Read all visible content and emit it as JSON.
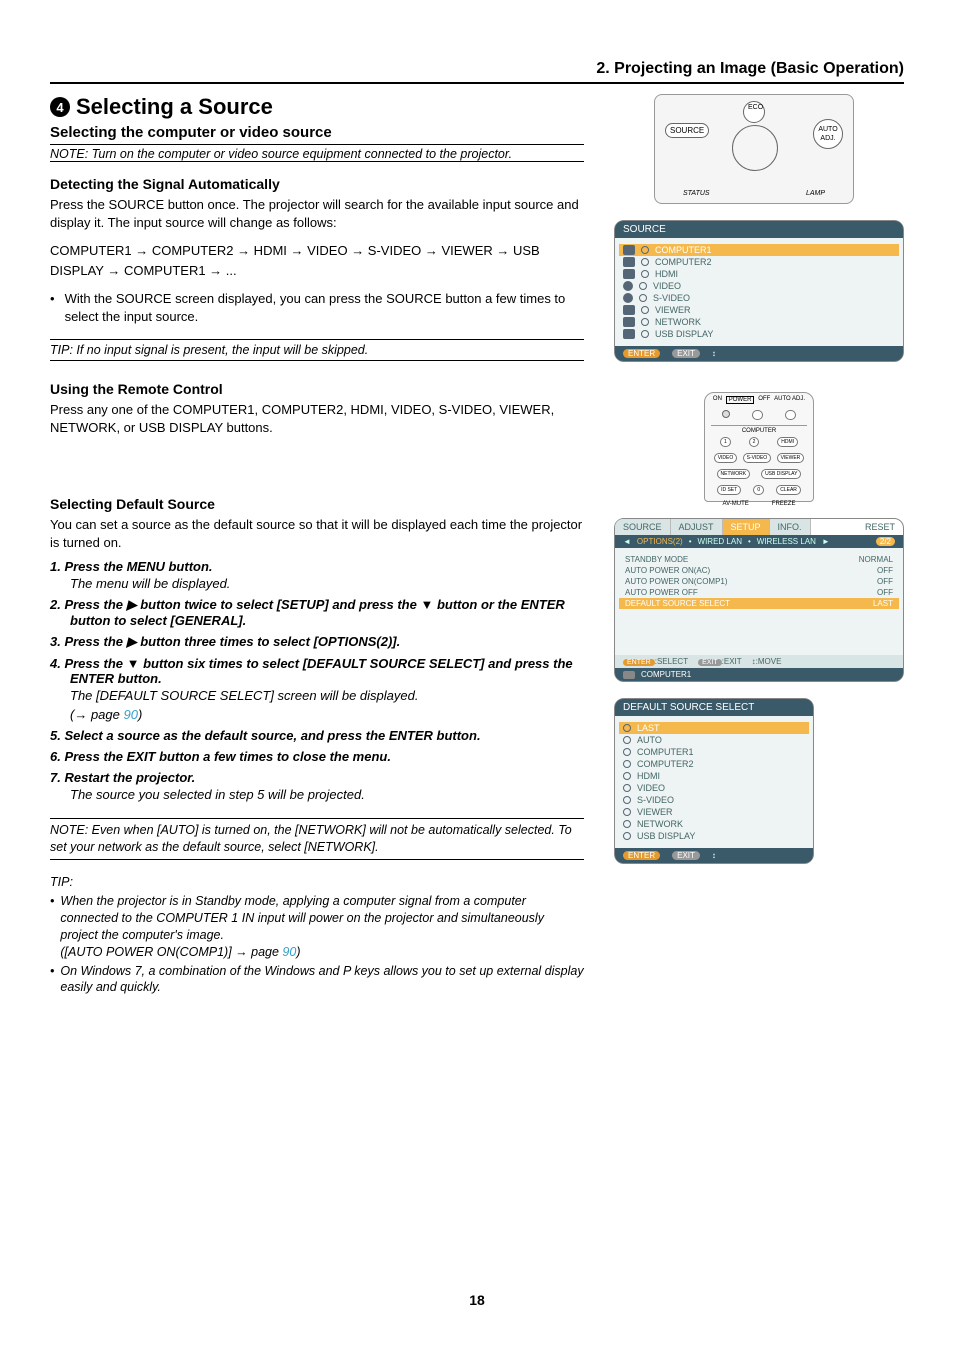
{
  "chapter_header": "2. Projecting an Image (Basic Operation)",
  "section": {
    "number": "4",
    "title": "Selecting a Source",
    "subhead": "Selecting the computer or video source",
    "note_top": "NOTE: Turn on the computer or video source equipment connected to the projector."
  },
  "detect": {
    "heading": "Detecting the Signal Automatically",
    "p1": "Press the SOURCE button once. The projector will search for the available input source and display it. The input source will change as follows:",
    "chain": "COMPUTER1 → COMPUTER2 → HDMI → VIDEO → S-VIDEO → VIEWER → USB DISPLAY → COMPUTER1 → ...",
    "bullet": "With the SOURCE screen displayed, you can press the SOURCE button a few times to select the input source.",
    "tip": "TIP: If no input signal is present, the input will be skipped."
  },
  "remote": {
    "heading": "Using the Remote Control",
    "p1": "Press any one of the COMPUTER1, COMPUTER2, HDMI, VIDEO, S-VIDEO, VIEWER, NETWORK, or USB DISPLAY buttons."
  },
  "default_source": {
    "heading": "Selecting Default Source",
    "intro": "You can set a source as the default source so that it will be displayed each time the projector is turned on.",
    "step1": "1.  Press the MENU button.",
    "step1_sub": "The menu will be displayed.",
    "step2": "2.  Press the ▶ button twice to select [SETUP] and press the ▼ button or the ENTER button to select [GENERAL].",
    "step3": "3.  Press the ▶ button three times to select [OPTIONS(2)].",
    "step4": "4.  Press the ▼ button six times to select [DEFAULT SOURCE SELECT] and press the ENTER button.",
    "step4_sub1": "The [DEFAULT SOURCE SELECT] screen will be displayed.",
    "step4_sub2_prefix": "(→ page ",
    "step4_sub2_link": "90",
    "step4_sub2_suffix": ")",
    "step5": "5.  Select a source as the default source, and press the ENTER button.",
    "step6": "6.  Press the EXIT button a few times to close the menu.",
    "step7": "7.  Restart the projector.",
    "step7_sub": "The source you selected in step 5 will be projected."
  },
  "note_bottom": "NOTE: Even when [AUTO] is turned on, the [NETWORK] will not be automatically selected. To set your network as the default source, select [NETWORK].",
  "tips": {
    "lead": "TIP:",
    "t1_a": "When the projector is in Standby mode, applying a computer signal from a computer connected to the COMPUTER 1 IN input will power on the projector and simultaneously project the computer's image.",
    "t1_b_prefix": "([AUTO POWER ON(COMP1)] → page ",
    "t1_b_link": "90",
    "t1_b_suffix": ")",
    "t2": "On Windows 7, a combination of the Windows and P keys allows you to set up external display easily and quickly."
  },
  "page_number": "18",
  "fig_control": {
    "source": "SOURCE",
    "eco": "ECO",
    "auto": "AUTO ADJ.",
    "status": "STATUS",
    "lamp": "LAMP"
  },
  "fig_source_osd": {
    "title": "SOURCE",
    "items": [
      "COMPUTER1",
      "COMPUTER2",
      "HDMI",
      "VIDEO",
      "S-VIDEO",
      "VIEWER",
      "NETWORK",
      "USB DISPLAY"
    ],
    "enter": "ENTER",
    "exit": "EXIT"
  },
  "fig_remote": {
    "on": "ON",
    "power": "POWER",
    "off": "OFF",
    "auto": "AUTO ADJ.",
    "computer": "COMPUTER",
    "hdmi": "HDMI",
    "video": "VIDEO",
    "svideo": "S-VIDEO",
    "viewer": "VIEWER",
    "network": "NETWORK",
    "usb": "USB DISPLAY",
    "idset": "ID SET",
    "clear": "CLEAR",
    "avmute": "AV-MUTE",
    "freeze": "FREEZE"
  },
  "fig_setup": {
    "tabs": [
      "SOURCE",
      "ADJUST",
      "SETUP",
      "INFO."
    ],
    "reset": "RESET",
    "subtabs_sel": "OPTIONS(2)",
    "subtabs": [
      "WIRED LAN",
      "WIRELESS LAN"
    ],
    "page": "2/2",
    "rows": [
      {
        "l": "STANDBY MODE",
        "r": "NORMAL"
      },
      {
        "l": "AUTO POWER ON(AC)",
        "r": "OFF"
      },
      {
        "l": "AUTO POWER ON(COMP1)",
        "r": "OFF"
      },
      {
        "l": "AUTO POWER OFF",
        "r": "OFF"
      }
    ],
    "sel_row": {
      "l": "DEFAULT SOURCE SELECT",
      "r": "LAST"
    },
    "footer1": {
      "enter": "ENTER",
      "select": ":SELECT",
      "exit": "EXIT",
      "exitlabel": ":EXIT",
      "move": ":MOVE"
    },
    "footer2": "COMPUTER1"
  },
  "fig_default": {
    "title": "DEFAULT SOURCE SELECT",
    "sel": "LAST",
    "items": [
      "AUTO",
      "COMPUTER1",
      "COMPUTER2",
      "HDMI",
      "VIDEO",
      "S-VIDEO",
      "VIEWER",
      "NETWORK",
      "USB DISPLAY"
    ],
    "enter": "ENTER",
    "exit": "EXIT"
  }
}
